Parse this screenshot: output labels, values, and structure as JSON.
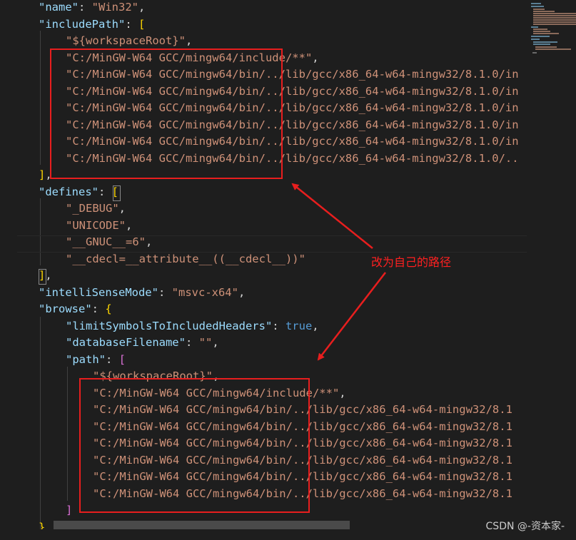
{
  "editor": {
    "lines": [
      {
        "tokens": [
          {
            "t": "\"name\"",
            "c": "k"
          },
          {
            "t": ": ",
            "c": "p"
          },
          {
            "t": "\"Win32\"",
            "c": "s"
          },
          {
            "t": ",",
            "c": "p"
          }
        ]
      },
      {
        "tokens": [
          {
            "t": "\"includePath\"",
            "c": "k"
          },
          {
            "t": ": ",
            "c": "p"
          },
          {
            "t": "[",
            "c": "br1"
          }
        ]
      },
      {
        "tokens": [
          {
            "t": "\"${workspaceRoot}\"",
            "c": "s"
          },
          {
            "t": ",",
            "c": "p"
          }
        ]
      },
      {
        "tokens": [
          {
            "t": "\"C:/MinGW-W64 GCC/mingw64/include/**\"",
            "c": "s"
          },
          {
            "t": ",",
            "c": "p"
          }
        ]
      },
      {
        "tokens": [
          {
            "t": "\"C:/MinGW-W64 GCC/mingw64/bin/../lib/gcc/x86_64-w64-mingw32/8.1.0/in",
            "c": "s"
          }
        ]
      },
      {
        "tokens": [
          {
            "t": "\"C:/MinGW-W64 GCC/mingw64/bin/../lib/gcc/x86_64-w64-mingw32/8.1.0/in",
            "c": "s"
          }
        ]
      },
      {
        "tokens": [
          {
            "t": "\"C:/MinGW-W64 GCC/mingw64/bin/../lib/gcc/x86_64-w64-mingw32/8.1.0/in",
            "c": "s"
          }
        ]
      },
      {
        "tokens": [
          {
            "t": "\"C:/MinGW-W64 GCC/mingw64/bin/../lib/gcc/x86_64-w64-mingw32/8.1.0/in",
            "c": "s"
          }
        ]
      },
      {
        "tokens": [
          {
            "t": "\"C:/MinGW-W64 GCC/mingw64/bin/../lib/gcc/x86_64-w64-mingw32/8.1.0/in",
            "c": "s"
          }
        ]
      },
      {
        "tokens": [
          {
            "t": "\"C:/MinGW-W64 GCC/mingw64/bin/../lib/gcc/x86_64-w64-mingw32/8.1.0/..",
            "c": "s"
          }
        ]
      },
      {
        "tokens": [
          {
            "t": "]",
            "c": "br1"
          },
          {
            "t": ",",
            "c": "p"
          }
        ]
      },
      {
        "tokens": [
          {
            "t": "\"defines\"",
            "c": "k"
          },
          {
            "t": ": ",
            "c": "p"
          },
          {
            "t": "[",
            "c": "br1"
          }
        ]
      },
      {
        "tokens": [
          {
            "t": "\"_DEBUG\"",
            "c": "s"
          },
          {
            "t": ",",
            "c": "p"
          }
        ]
      },
      {
        "tokens": [
          {
            "t": "\"UNICODE\"",
            "c": "s"
          },
          {
            "t": ",",
            "c": "p"
          }
        ]
      },
      {
        "tokens": [
          {
            "t": "\"__GNUC__=6\"",
            "c": "s"
          },
          {
            "t": ",",
            "c": "p"
          }
        ]
      },
      {
        "tokens": [
          {
            "t": "\"__cdecl=__attribute__((__cdecl__))\"",
            "c": "s"
          }
        ]
      },
      {
        "tokens": [
          {
            "t": "]",
            "c": "br1"
          },
          {
            "t": ",",
            "c": "p"
          }
        ]
      },
      {
        "tokens": [
          {
            "t": "\"intelliSenseMode\"",
            "c": "k"
          },
          {
            "t": ": ",
            "c": "p"
          },
          {
            "t": "\"msvc-x64\"",
            "c": "s"
          },
          {
            "t": ",",
            "c": "p"
          }
        ]
      },
      {
        "tokens": [
          {
            "t": "\"browse\"",
            "c": "k"
          },
          {
            "t": ": ",
            "c": "p"
          },
          {
            "t": "{",
            "c": "br1"
          }
        ]
      },
      {
        "tokens": [
          {
            "t": "\"limitSymbolsToIncludedHeaders\"",
            "c": "k"
          },
          {
            "t": ": ",
            "c": "p"
          },
          {
            "t": "true",
            "c": "b"
          },
          {
            "t": ",",
            "c": "p"
          }
        ]
      },
      {
        "tokens": [
          {
            "t": "\"databaseFilename\"",
            "c": "k"
          },
          {
            "t": ": ",
            "c": "p"
          },
          {
            "t": "\"\"",
            "c": "s"
          },
          {
            "t": ",",
            "c": "p"
          }
        ]
      },
      {
        "tokens": [
          {
            "t": "\"path\"",
            "c": "k"
          },
          {
            "t": ": ",
            "c": "p"
          },
          {
            "t": "[",
            "c": "br2"
          }
        ]
      },
      {
        "tokens": [
          {
            "t": "\"${workspaceRoot}\"",
            "c": "s"
          },
          {
            "t": ",",
            "c": "p"
          }
        ]
      },
      {
        "tokens": [
          {
            "t": "\"C:/MinGW-W64 GCC/mingw64/include/**\"",
            "c": "s"
          },
          {
            "t": ",",
            "c": "p"
          }
        ]
      },
      {
        "tokens": [
          {
            "t": "\"C:/MinGW-W64 GCC/mingw64/bin/../lib/gcc/x86_64-w64-mingw32/8.1",
            "c": "s"
          }
        ]
      },
      {
        "tokens": [
          {
            "t": "\"C:/MinGW-W64 GCC/mingw64/bin/../lib/gcc/x86_64-w64-mingw32/8.1",
            "c": "s"
          }
        ]
      },
      {
        "tokens": [
          {
            "t": "\"C:/MinGW-W64 GCC/mingw64/bin/../lib/gcc/x86_64-w64-mingw32/8.1",
            "c": "s"
          }
        ]
      },
      {
        "tokens": [
          {
            "t": "\"C:/MinGW-W64 GCC/mingw64/bin/../lib/gcc/x86_64-w64-mingw32/8.1",
            "c": "s"
          }
        ]
      },
      {
        "tokens": [
          {
            "t": "\"C:/MinGW-W64 GCC/mingw64/bin/../lib/gcc/x86_64-w64-mingw32/8.1",
            "c": "s"
          }
        ]
      },
      {
        "tokens": [
          {
            "t": "\"C:/MinGW-W64 GCC/mingw64/bin/../lib/gcc/x86_64-w64-mingw32/8.1",
            "c": "s"
          }
        ]
      },
      {
        "tokens": [
          {
            "t": "]",
            "c": "br2"
          }
        ]
      },
      {
        "tokens": [
          {
            "t": "}",
            "c": "br1"
          }
        ]
      }
    ]
  },
  "annotation": {
    "text": "改为自己的路径"
  },
  "watermark": {
    "text": "CSDN @-资本家-"
  },
  "colors": {
    "background": "#1e1e1e",
    "property_key": "#9cdcfe",
    "string_value": "#ce9178",
    "keyword": "#569cd6",
    "bracket_gold": "#ffd700",
    "bracket_purple": "#da70d6",
    "annotation_red": "#e81e1e"
  }
}
